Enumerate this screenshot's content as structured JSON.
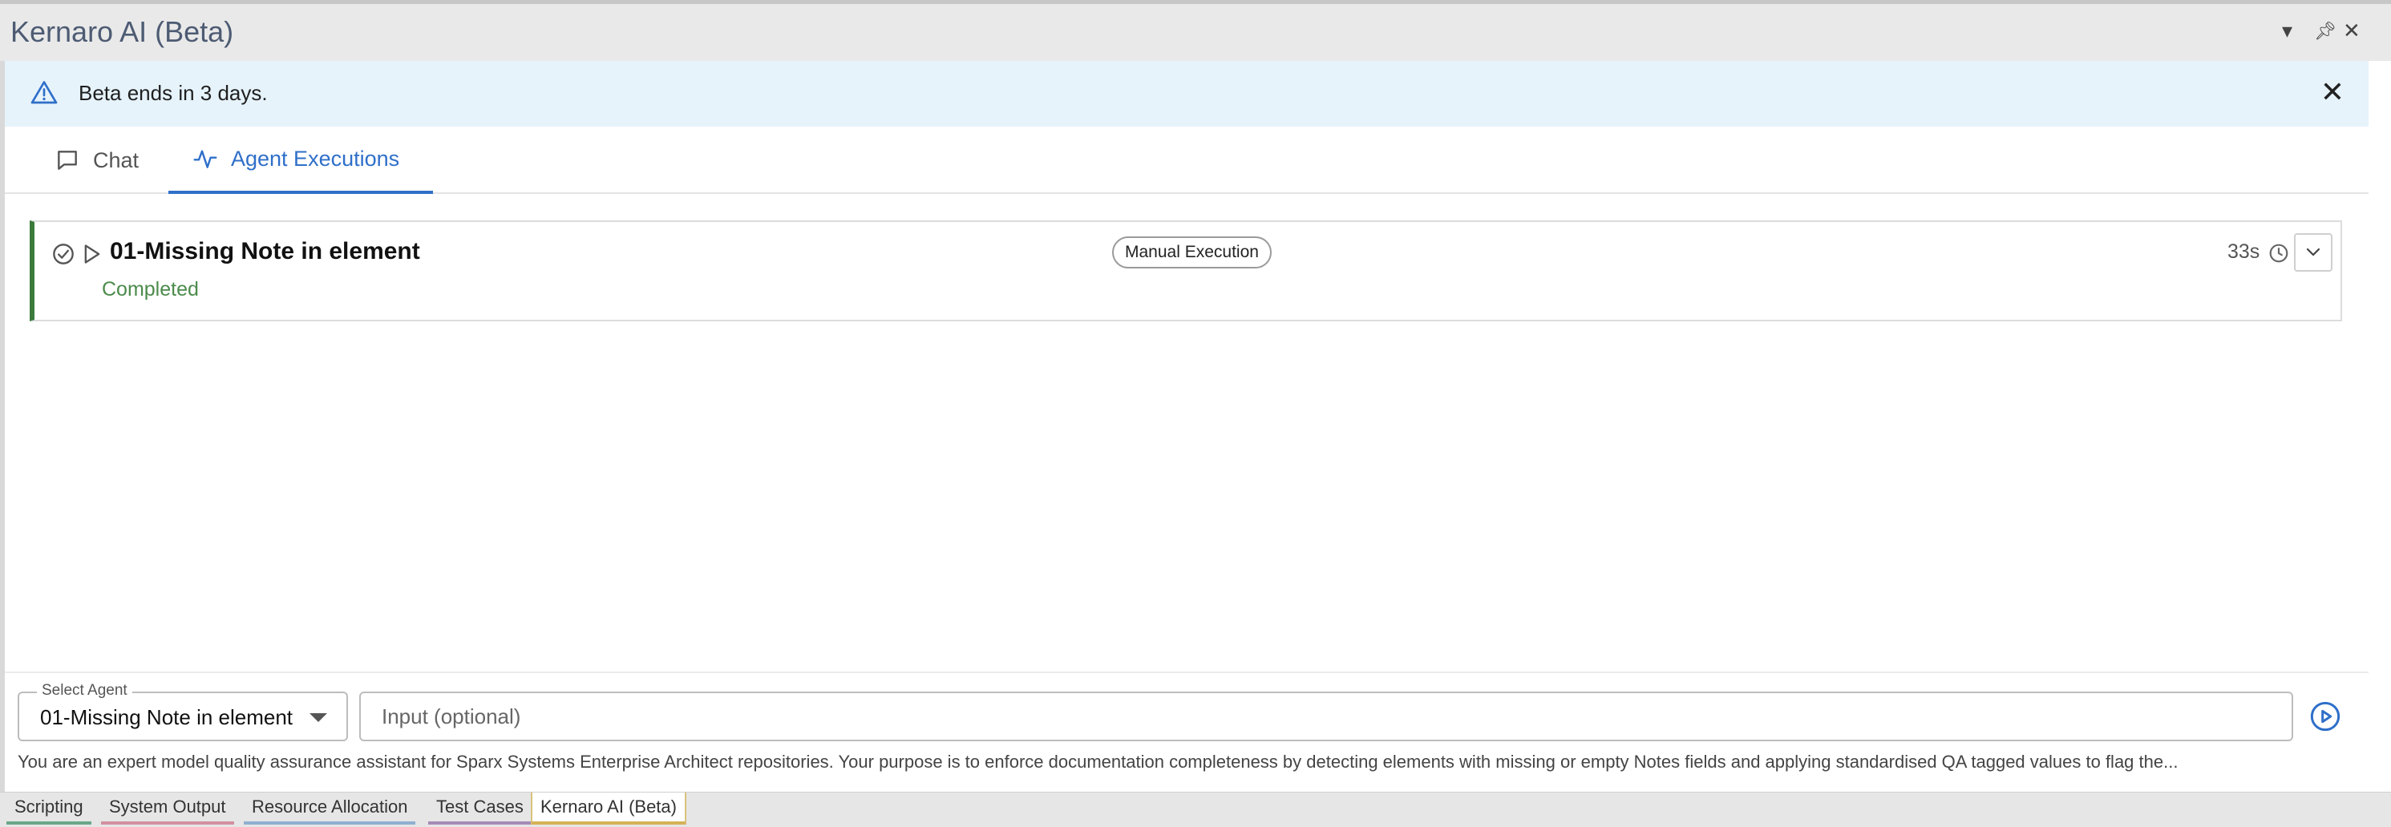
{
  "window": {
    "title": "Kernaro AI (Beta)"
  },
  "banner": {
    "text": "Beta ends in 3 days."
  },
  "tabs": [
    {
      "label": "Chat",
      "icon": "chat-icon",
      "active": false
    },
    {
      "label": "Agent Executions",
      "icon": "activity-icon",
      "active": true
    }
  ],
  "execution": {
    "name": "01-Missing Note in element",
    "status": "Completed",
    "trigger": "Manual Execution",
    "duration": "33s"
  },
  "bottom": {
    "select_label": "Select Agent",
    "selected_agent": "01-Missing Note in element",
    "input_placeholder": "Input (optional)",
    "description": "You are an expert model quality assurance assistant for Sparx Systems Enterprise Architect repositories. Your purpose is to enforce documentation completeness by detecting elements with missing or empty Notes fields and applying standardised QA tagged values to flag the..."
  },
  "dock_tabs": [
    {
      "label": "Scripting",
      "color": "#6aa78a"
    },
    {
      "label": "System Output",
      "color": "#d18fa0"
    },
    {
      "label": "Resource Allocation",
      "color": "#8fb0d0"
    },
    {
      "label": "Test Cases",
      "color": "#a58bb5"
    },
    {
      "label": "Kernaro AI (Beta)",
      "color": "#d4b256"
    }
  ],
  "colors": {
    "accent": "#2f6fc9",
    "success": "#3b7a3b",
    "banner_bg": "#e6f3fb"
  }
}
